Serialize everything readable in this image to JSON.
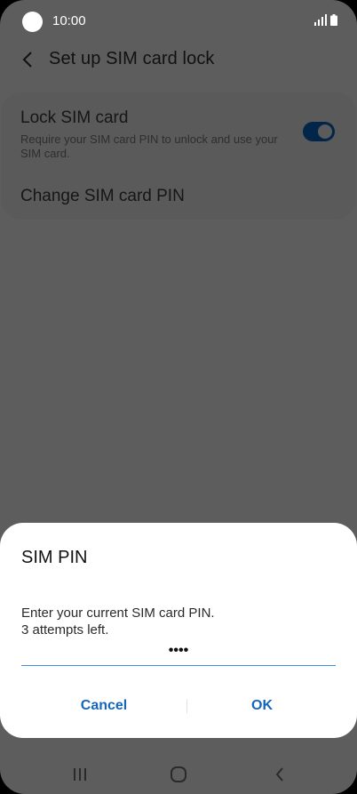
{
  "status_bar": {
    "time": "10:00"
  },
  "app_bar": {
    "title": "Set up SIM card lock"
  },
  "settings": {
    "lock_sim": {
      "title": "Lock SIM card",
      "description": "Require your SIM card PIN to unlock and use your SIM card.",
      "enabled": true
    },
    "change_pin": {
      "title": "Change SIM card PIN"
    }
  },
  "dialog": {
    "title": "SIM PIN",
    "message_line1": "Enter your current SIM card PIN.",
    "message_line2": "3 attempts left.",
    "pin_value": "••••",
    "cancel_label": "Cancel",
    "ok_label": "OK"
  },
  "colors": {
    "scrim": "#5d5d5d",
    "accent": "#1566ba",
    "field_underline": "#3e91e0",
    "toggle_on": "#02264a"
  },
  "icons": {
    "back": "chevron-left-icon",
    "signal": "signal-icon",
    "battery": "battery-icon",
    "recents": "recents-icon",
    "home": "home-icon",
    "nav_back": "nav-back-icon"
  }
}
